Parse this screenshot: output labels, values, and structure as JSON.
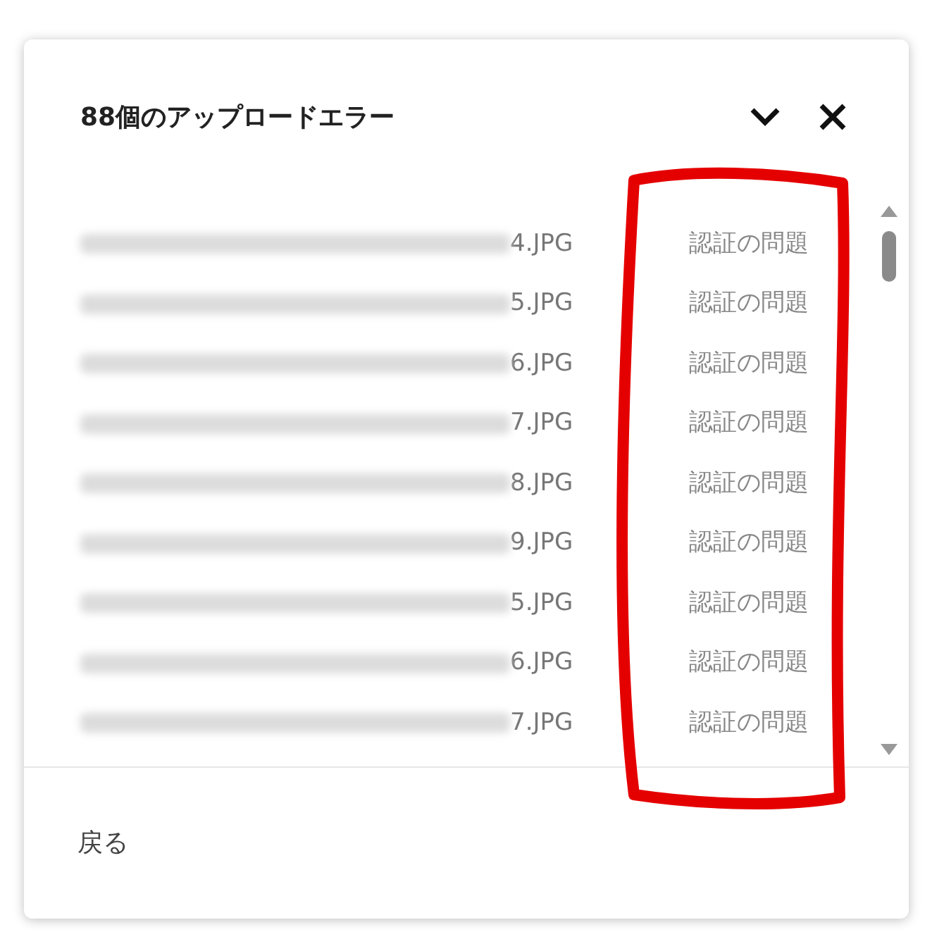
{
  "dialog": {
    "title": "88個のアップロードエラー"
  },
  "errors": [
    {
      "file": "4.JPG",
      "issue": "認証の問題"
    },
    {
      "file": "5.JPG",
      "issue": "認証の問題"
    },
    {
      "file": "6.JPG",
      "issue": "認証の問題"
    },
    {
      "file": "7.JPG",
      "issue": "認証の問題"
    },
    {
      "file": "8.JPG",
      "issue": "認証の問題"
    },
    {
      "file": "9.JPG",
      "issue": "認証の問題"
    },
    {
      "file": "5.JPG",
      "issue": "認証の問題"
    },
    {
      "file": "6.JPG",
      "issue": "認証の問題"
    },
    {
      "file": "7.JPG",
      "issue": "認証の問題"
    }
  ],
  "footer": {
    "back_label": "戻る"
  }
}
